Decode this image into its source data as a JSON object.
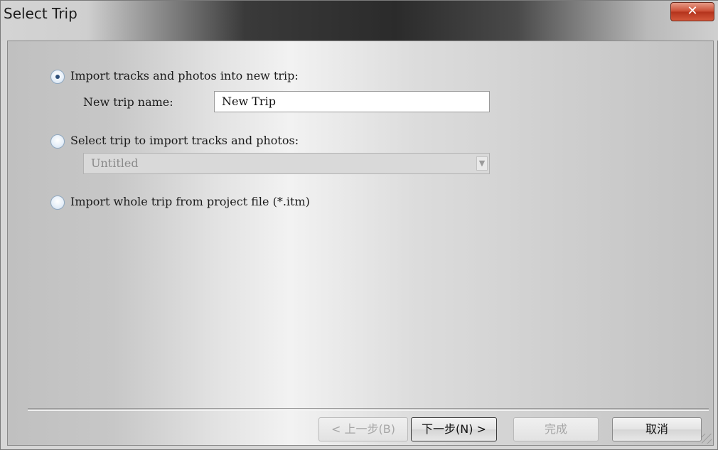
{
  "window": {
    "title": "Select Trip",
    "close_icon": "✕"
  },
  "options": {
    "new_trip": {
      "label": "Import tracks and photos into new trip:",
      "selected": true
    },
    "new_trip_name_label": "New trip name:",
    "new_trip_name_value": "New Trip",
    "select_trip": {
      "label": "Select trip to import tracks and photos:",
      "selected": false
    },
    "select_trip_combo_value": "Untitled",
    "whole_trip": {
      "label": "Import whole trip from project file (*.itm)",
      "selected": false
    }
  },
  "buttons": {
    "back": "< 上一步(B)",
    "next": "下一步(N) >",
    "finish": "完成",
    "cancel": "取消"
  },
  "colors": {
    "close_button": "#c94a30",
    "radio_dot": "#2d4f7a"
  }
}
